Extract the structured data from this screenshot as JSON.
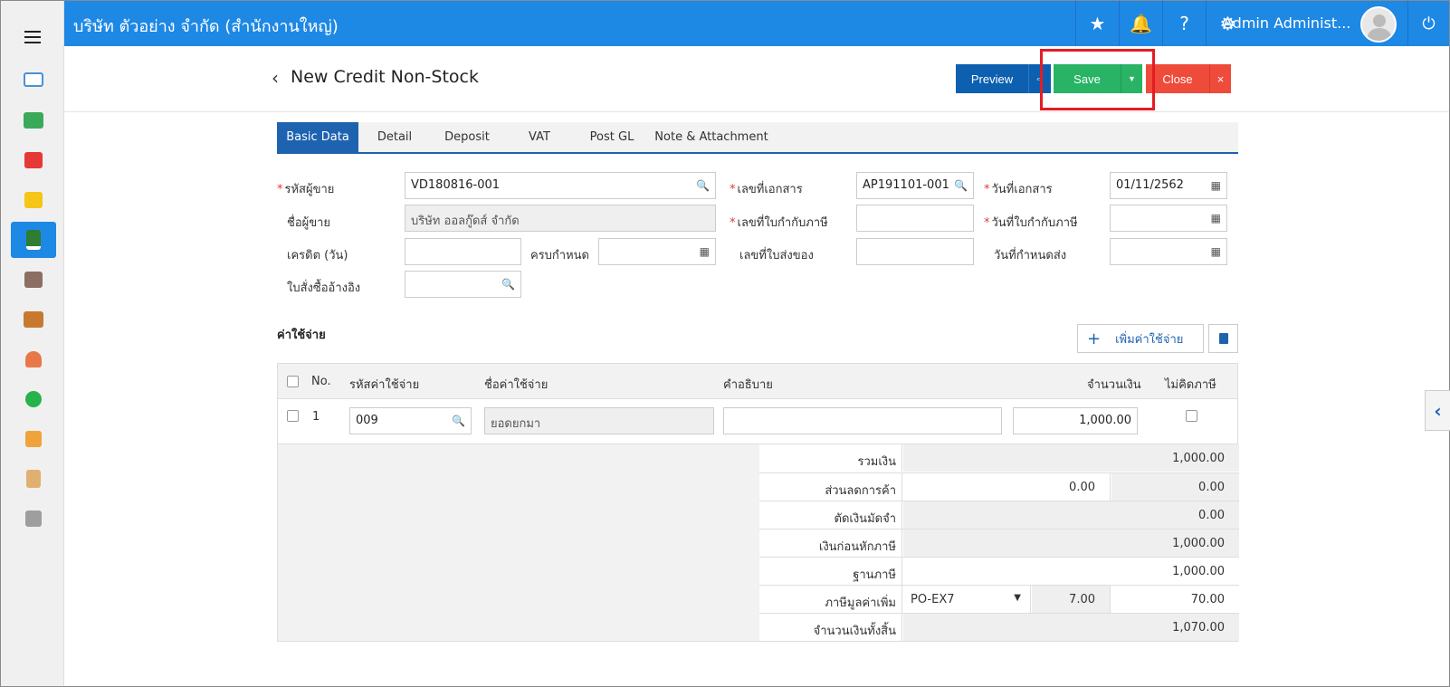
{
  "topbar": {
    "company": "บริษัท ตัวอย่าง จำกัด (สำนักงานใหญ่)",
    "user": "Admin Administ..."
  },
  "page": {
    "title": "New Credit Non-Stock"
  },
  "actions": {
    "preview": "Preview",
    "save": "Save",
    "close": "Close"
  },
  "tabs": [
    "Basic Data",
    "Detail",
    "Deposit",
    "VAT",
    "Post GL",
    "Note & Attachment"
  ],
  "form": {
    "vendor_code_label": "รหัสผู้ขาย",
    "vendor_code": "VD180816-001",
    "vendor_name_label": "ชื่อผู้ขาย",
    "vendor_name": "บริษัท ออลกู๊ดส์ จำกัด",
    "credit_label": "เครดิต (วัน)",
    "credit": "",
    "due_label": "ครบกำหนด",
    "due": "",
    "po_ref_label": "ใบสั่งซื้ออ้างอิง",
    "po_ref": "",
    "doc_no_label": "เลขที่เอกสาร",
    "doc_no": "AP191101-001",
    "tax_inv_no_label": "เลขที่ใบกำกับภาษี",
    "tax_inv_no": "",
    "delivery_no_label": "เลขที่ใบส่งของ",
    "delivery_no": "",
    "doc_date_label": "วันที่เอกสาร",
    "doc_date": "01/11/2562",
    "tax_inv_date_label": "วันที่ใบกำกับภาษี",
    "tax_inv_date": "",
    "delivery_date_label": "วันที่กำหนดส่ง",
    "delivery_date": ""
  },
  "expense": {
    "title": "ค่าใช้จ่าย",
    "add_label": "เพิ่มค่าใช้จ่าย",
    "columns": {
      "no": "No.",
      "code": "รหัสค่าใช้จ่าย",
      "name": "ชื่อค่าใช้จ่าย",
      "desc": "คำอธิบาย",
      "amount": "จำนวนเงิน",
      "no_tax": "ไม่คิดภาษี"
    },
    "rows": [
      {
        "no": "1",
        "code": "009",
        "name": "ยอดยกมา",
        "desc": "",
        "amount": "1,000.00"
      }
    ]
  },
  "totals": {
    "sum_label": "รวมเงิน",
    "sum": "1,000.00",
    "discount_label": "ส่วนลดการค้า",
    "discount_input": "0.00",
    "discount": "0.00",
    "deposit_label": "ตัดเงินมัดจำ",
    "deposit": "0.00",
    "before_tax_label": "เงินก่อนหักภาษี",
    "before_tax": "1,000.00",
    "tax_base_label": "ฐานภาษี",
    "tax_base": "1,000.00",
    "vat_label": "ภาษีมูลค่าเพิ่ม",
    "vat_code": "PO-EX7",
    "vat_rate": "7.00",
    "vat": "70.00",
    "grand_label": "จำนวนเงินทั้งสิ้น",
    "grand": "1,070.00"
  },
  "colors": {
    "primary": "#1e88e5",
    "save": "#28b464",
    "close": "#ef4b3b",
    "preview": "#0d5fb0"
  }
}
